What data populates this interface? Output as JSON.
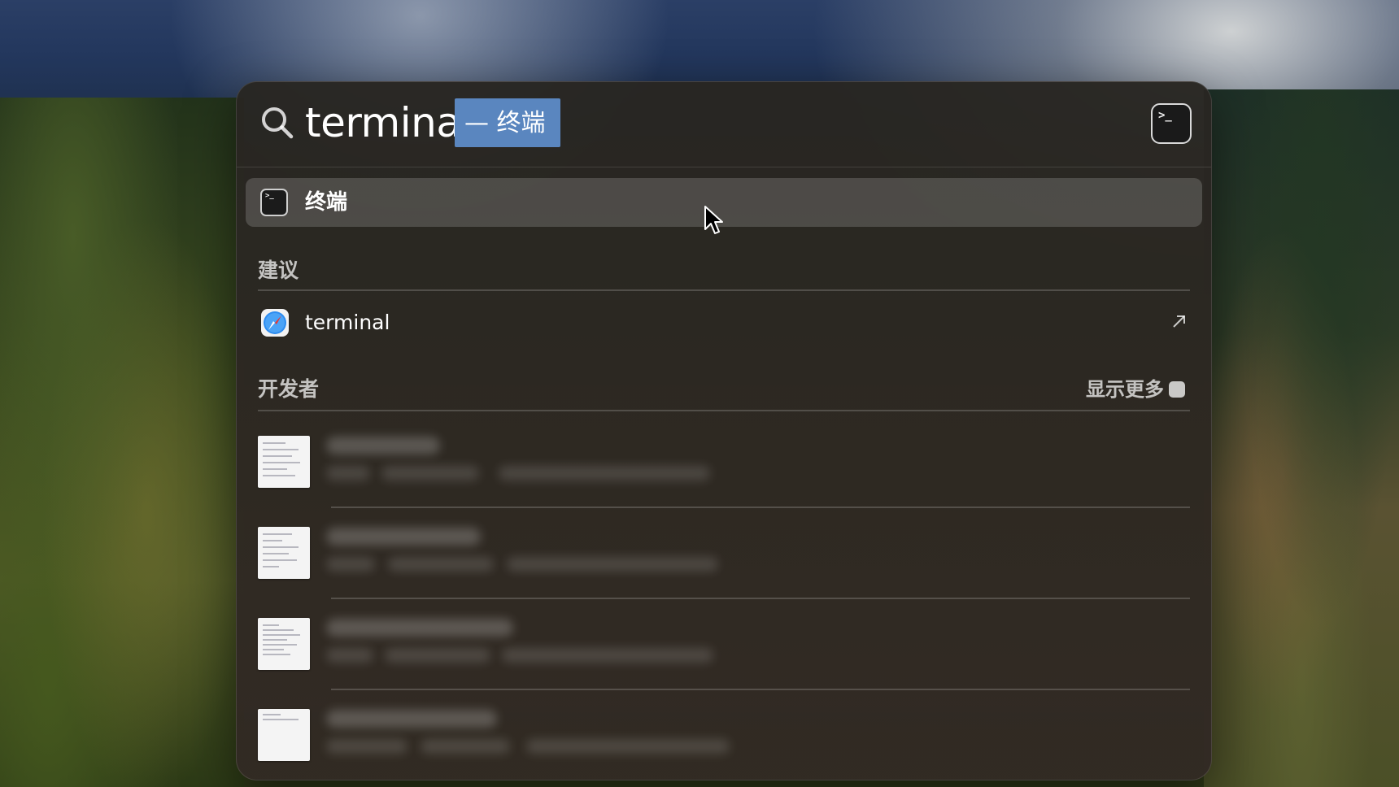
{
  "search": {
    "query": "terminal",
    "completion": "— 终端"
  },
  "top_hit": {
    "label": "终端",
    "icon": "terminal-icon"
  },
  "suggestions": {
    "title": "建议",
    "items": [
      {
        "label": "terminal",
        "icon": "safari-icon",
        "action_icon": "arrow-up-right-icon"
      }
    ]
  },
  "developer": {
    "title": "开发者",
    "show_more": "显示更多"
  }
}
